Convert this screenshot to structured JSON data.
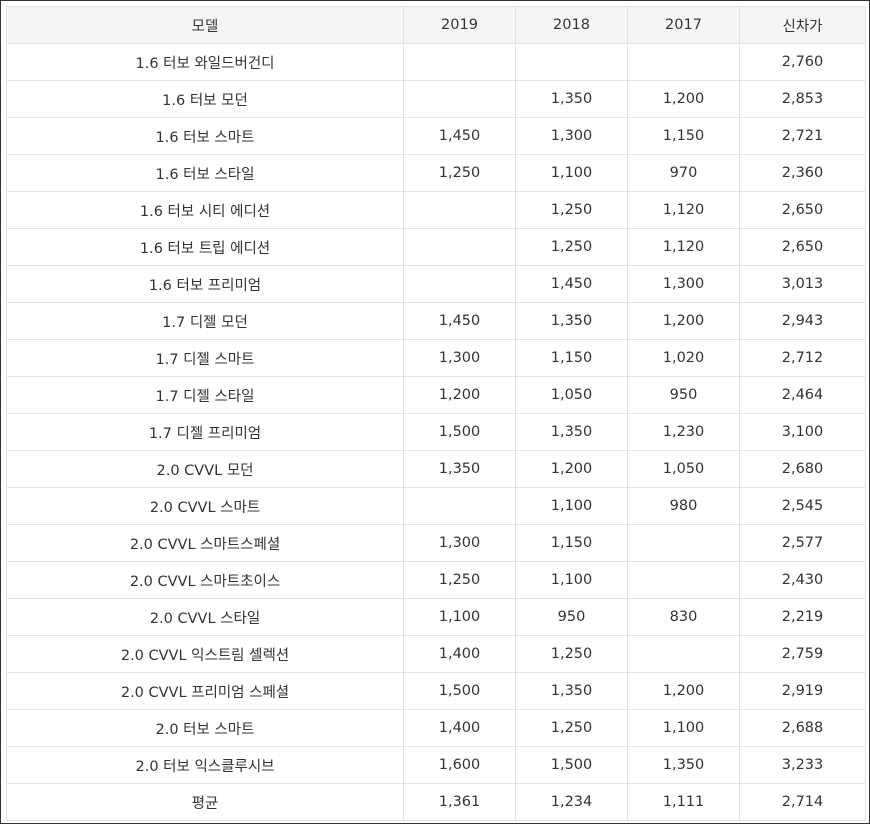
{
  "table": {
    "headers": [
      "모델",
      "2019",
      "2018",
      "2017",
      "신차가"
    ],
    "rows": [
      [
        "1.6 터보 와일드버건디",
        "",
        "",
        "",
        "2,760"
      ],
      [
        "1.6 터보 모던",
        "",
        "1,350",
        "1,200",
        "2,853"
      ],
      [
        "1.6 터보 스마트",
        "1,450",
        "1,300",
        "1,150",
        "2,721"
      ],
      [
        "1.6 터보 스타일",
        "1,250",
        "1,100",
        "970",
        "2,360"
      ],
      [
        "1.6 터보 시티 에디션",
        "",
        "1,250",
        "1,120",
        "2,650"
      ],
      [
        "1.6 터보 트립 에디션",
        "",
        "1,250",
        "1,120",
        "2,650"
      ],
      [
        "1.6 터보 프리미엄",
        "",
        "1,450",
        "1,300",
        "3,013"
      ],
      [
        "1.7 디젤 모던",
        "1,450",
        "1,350",
        "1,200",
        "2,943"
      ],
      [
        "1.7 디젤 스마트",
        "1,300",
        "1,150",
        "1,020",
        "2,712"
      ],
      [
        "1.7 디젤 스타일",
        "1,200",
        "1,050",
        "950",
        "2,464"
      ],
      [
        "1.7 디젤 프리미엄",
        "1,500",
        "1,350",
        "1,230",
        "3,100"
      ],
      [
        "2.0 CVVL 모던",
        "1,350",
        "1,200",
        "1,050",
        "2,680"
      ],
      [
        "2.0 CVVL 스마트",
        "",
        "1,100",
        "980",
        "2,545"
      ],
      [
        "2.0 CVVL 스마트스페셜",
        "1,300",
        "1,150",
        "",
        "2,577"
      ],
      [
        "2.0 CVVL 스마트초이스",
        "1,250",
        "1,100",
        "",
        "2,430"
      ],
      [
        "2.0 CVVL 스타일",
        "1,100",
        "950",
        "830",
        "2,219"
      ],
      [
        "2.0 CVVL 익스트림 셀렉션",
        "1,400",
        "1,250",
        "",
        "2,759"
      ],
      [
        "2.0 CVVL 프리미엄 스페셜",
        "1,500",
        "1,350",
        "1,200",
        "2,919"
      ],
      [
        "2.0 터보 스마트",
        "1,400",
        "1,250",
        "1,100",
        "2,688"
      ],
      [
        "2.0 터보 익스클루시브",
        "1,600",
        "1,500",
        "1,350",
        "3,233"
      ],
      [
        "평균",
        "1,361",
        "1,234",
        "1,111",
        "2,714"
      ]
    ]
  }
}
